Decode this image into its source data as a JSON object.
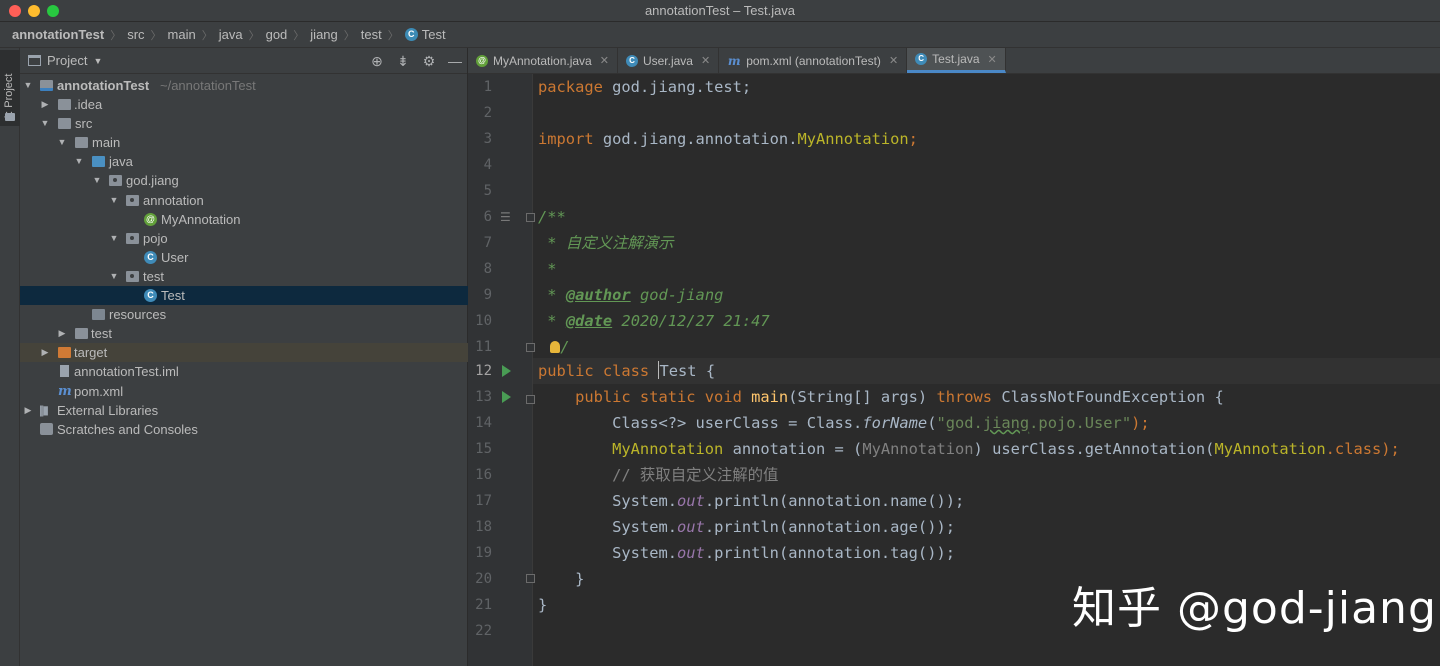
{
  "window": {
    "title": "annotationTest – Test.java"
  },
  "breadcrumb": [
    "annotationTest",
    "src",
    "main",
    "java",
    "god",
    "jiang",
    "test",
    "Test"
  ],
  "toolstrip": {
    "project_tab": "1: Project"
  },
  "project_panel": {
    "title": "Project",
    "tree": [
      {
        "label": "annotationTest",
        "suffix": "~/annotationTest",
        "icon": "module-folder-icon"
      },
      {
        "label": ".idea",
        "icon": "folder-icon"
      },
      {
        "label": "src",
        "icon": "folder-icon"
      },
      {
        "label": "main",
        "icon": "folder-icon"
      },
      {
        "label": "java",
        "icon": "source-folder-icon"
      },
      {
        "label": "god.jiang",
        "icon": "package-icon"
      },
      {
        "label": "annotation",
        "icon": "package-icon"
      },
      {
        "label": "MyAnnotation",
        "icon": "annotation-icon"
      },
      {
        "label": "pojo",
        "icon": "package-icon"
      },
      {
        "label": "User",
        "icon": "class-icon"
      },
      {
        "label": "test",
        "icon": "package-icon"
      },
      {
        "label": "Test",
        "icon": "class-icon"
      },
      {
        "label": "resources",
        "icon": "resources-folder-icon"
      },
      {
        "label": "test",
        "icon": "folder-icon"
      },
      {
        "label": "target",
        "icon": "excluded-folder-icon"
      },
      {
        "label": "annotationTest.iml",
        "icon": "iml-file-icon"
      },
      {
        "label": "pom.xml",
        "icon": "maven-icon"
      },
      {
        "label": "External Libraries",
        "icon": "libraries-icon"
      },
      {
        "label": "Scratches and Consoles",
        "icon": "scratches-icon"
      }
    ]
  },
  "tabs": [
    {
      "label": "MyAnnotation.java",
      "icon": "annotation-icon"
    },
    {
      "label": "User.java",
      "icon": "class-icon"
    },
    {
      "label": "pom.xml (annotationTest)",
      "icon": "maven-icon"
    },
    {
      "label": "Test.java",
      "icon": "class-icon",
      "active": true
    }
  ],
  "editor": {
    "line_numbers": [
      "1",
      "2",
      "3",
      "4",
      "5",
      "6",
      "7",
      "8",
      "9",
      "10",
      "11",
      "12",
      "13",
      "14",
      "15",
      "16",
      "17",
      "18",
      "19",
      "20",
      "21",
      "22"
    ],
    "current_line": "12",
    "code": {
      "l1_kw": "package",
      "l1_rest": " god.jiang.test;",
      "l3_kw": "import",
      "l3_pkg": " god.jiang.annotation.",
      "l3_cls": "MyAnnotation",
      "l3_end": ";",
      "l6": "/**",
      "l7": " * 自定义注解演示",
      "l8": " *",
      "l9_pre": " * ",
      "l9_tag": "@author",
      "l9_val": " god-jiang",
      "l10_pre": " * ",
      "l10_tag": "@date",
      "l10_val": " 2020/12/27 21:47",
      "l11_pre": " ",
      "l11_end": "/",
      "l12_kw": "public class ",
      "l12_name": "Test",
      "l12_end": " {",
      "l13_kw": "    public static void ",
      "l13_fn": "main",
      "l13_args": "(String[] args) ",
      "l13_throws": "throws",
      "l13_exc": " ClassNotFoundException {",
      "l14_a": "        Class<?> userClass = Class.",
      "l14_fn": "forName",
      "l14_b": "(",
      "l14_str1": "\"god.",
      "l14_str2": "jiang",
      "l14_str3": ".pojo.User\"",
      "l14_c": ");",
      "l15_an": "        MyAnnotation",
      "l15_a": " annotation = (",
      "l15_cast": "MyAnnotation",
      "l15_b": ") userClass.getAnnotation(",
      "l15_an2": "MyAnnotation",
      "l15_kw": ".class",
      "l15_c": ");",
      "l16": "        // 获取自定义注解的值",
      "l17_a": "        System.",
      "l17_out": "out",
      "l17_b": ".println(annotation.name());",
      "l18_a": "        System.",
      "l18_out": "out",
      "l18_b": ".println(annotation.age());",
      "l19_a": "        System.",
      "l19_out": "out",
      "l19_b": ".println(annotation.tag());",
      "l20": "    }",
      "l21": "}"
    }
  },
  "watermark": "知乎 @god-jiang"
}
